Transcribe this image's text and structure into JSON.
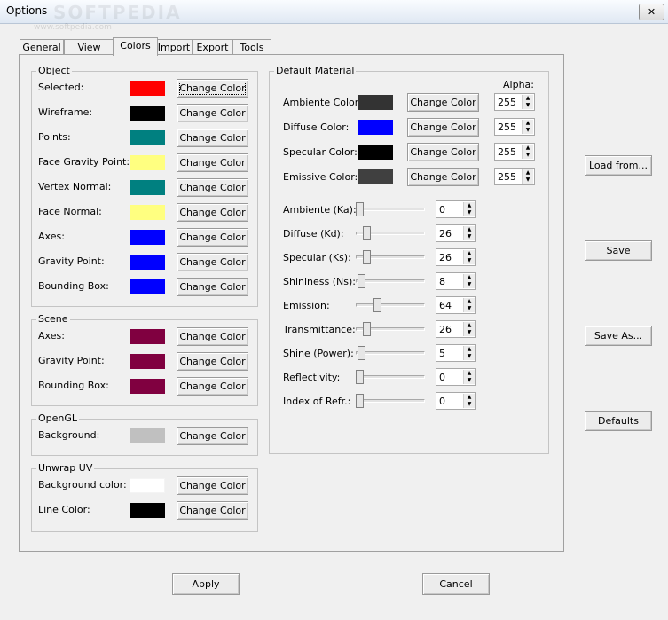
{
  "window": {
    "title": "Options",
    "close_label": "✕",
    "watermark": "SOFTPEDIA",
    "watermark_url": "www.softpedia.com"
  },
  "tabs": [
    {
      "label": "General"
    },
    {
      "label": "View"
    },
    {
      "label": "Colors"
    },
    {
      "label": "Import"
    },
    {
      "label": "Export"
    },
    {
      "label": "Tools"
    }
  ],
  "active_tab": "Colors",
  "change_color_label": "Change Color",
  "object": {
    "title": "Object",
    "rows": [
      {
        "label": "Selected:",
        "color": "#ff0000"
      },
      {
        "label": "Wireframe:",
        "color": "#000000"
      },
      {
        "label": "Points:",
        "color": "#008080"
      },
      {
        "label": "Face Gravity Point:",
        "color": "#ffff80"
      },
      {
        "label": "Vertex Normal:",
        "color": "#008080"
      },
      {
        "label": "Face Normal:",
        "color": "#ffff80"
      },
      {
        "label": "Axes:",
        "color": "#0000ff"
      },
      {
        "label": "Gravity Point:",
        "color": "#0000ff"
      },
      {
        "label": "Bounding Box:",
        "color": "#0000ff"
      }
    ]
  },
  "scene": {
    "title": "Scene",
    "rows": [
      {
        "label": "Axes:",
        "color": "#800040"
      },
      {
        "label": "Gravity Point:",
        "color": "#800040"
      },
      {
        "label": "Bounding Box:",
        "color": "#800040"
      }
    ]
  },
  "opengl": {
    "title": "OpenGL",
    "rows": [
      {
        "label": "Background:",
        "color": "#c0c0c0"
      }
    ]
  },
  "unwrap": {
    "title": "Unwrap UV",
    "rows": [
      {
        "label": "Background color:",
        "color": "#ffffff"
      },
      {
        "label": "Line Color:",
        "color": "#000000"
      }
    ]
  },
  "material": {
    "title": "Default Material",
    "alpha_label": "Alpha:",
    "colors": [
      {
        "label": "Ambiente Color:",
        "color": "#333333",
        "alpha": "255"
      },
      {
        "label": "Diffuse Color:",
        "color": "#0000ff",
        "alpha": "255"
      },
      {
        "label": "Specular Color:",
        "color": "#000000",
        "alpha": "255"
      },
      {
        "label": "Emissive Color:",
        "color": "#404040",
        "alpha": "255"
      }
    ],
    "sliders": [
      {
        "label": "Ambiente (Ka):",
        "value": "0",
        "level": 0
      },
      {
        "label": "Diffuse (Kd):",
        "value": "26",
        "level": 0.1
      },
      {
        "label": "Specular (Ks):",
        "value": "26",
        "level": 0.1
      },
      {
        "label": "Shininess (Ns):",
        "value": "8",
        "level": 0.03
      },
      {
        "label": "Emission:",
        "value": "64",
        "level": 0.25
      },
      {
        "label": "Transmittance:",
        "value": "26",
        "level": 0.1
      },
      {
        "label": "Shine (Power):",
        "value": "5",
        "level": 0.02
      },
      {
        "label": "Reflectivity:",
        "value": "0",
        "level": 0
      },
      {
        "label": "Index of Refr.:",
        "value": "0",
        "level": 0
      }
    ]
  },
  "side_buttons": [
    "Load from...",
    "Save",
    "Save As...",
    "Defaults"
  ],
  "footer": {
    "apply": "Apply",
    "cancel": "Cancel"
  }
}
